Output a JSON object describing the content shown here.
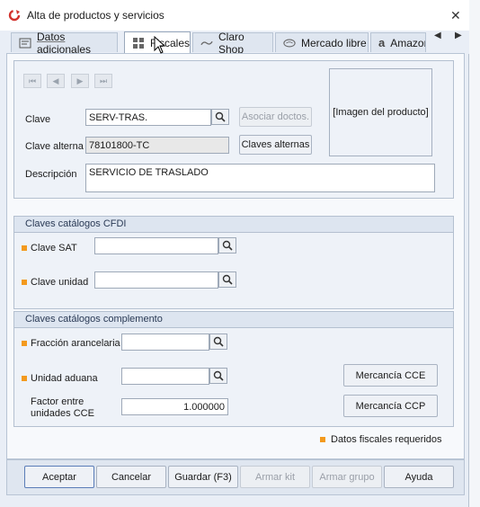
{
  "window": {
    "title": "Alta de productos y servicios",
    "close_glyph": "✕"
  },
  "tabs": [
    {
      "label": "Datos adicionales",
      "icon": "datos-icon"
    },
    {
      "label": "Fiscales",
      "icon": "grid-icon"
    },
    {
      "label": "Claro Shop",
      "icon": "claro-icon"
    },
    {
      "label": "Mercado libre",
      "icon": "mercado-icon"
    },
    {
      "label": "Amazon",
      "icon": "amazon-icon"
    }
  ],
  "tab_scroll": {
    "left": "◀",
    "right": "▶"
  },
  "nav": {
    "first": "⏮",
    "prev": "◀",
    "next": "▶",
    "last": "⏭"
  },
  "product": {
    "clave_label": "Clave",
    "clave_value": "SERV-TRAS.",
    "asociar_label": "Asociar doctos.",
    "clave_alterna_label": "Clave alterna",
    "clave_alterna_value": "78101800-TC",
    "claves_alternas_label": "Claves alternas",
    "descripcion_label": "Descripción",
    "descripcion_value": "SERVICIO DE TRASLADO",
    "image_placeholder": "[Imagen del producto]"
  },
  "cfdi": {
    "title": "Claves catálogos CFDI",
    "clave_sat_label": "Clave SAT",
    "clave_sat_value": "",
    "clave_unidad_label": "Clave unidad",
    "clave_unidad_value": ""
  },
  "complemento": {
    "title": "Claves catálogos complemento",
    "fraccion_label": "Fracción arancelaria",
    "fraccion_value": "",
    "unidad_aduana_label": "Unidad aduana",
    "unidad_aduana_value": "",
    "factor_label_1": "Factor entre",
    "factor_label_2": "unidades CCE",
    "factor_value": "1.000000",
    "mercancia_cce_label": "Mercancía CCE",
    "mercancia_ccp_label": "Mercancía CCP"
  },
  "legend": {
    "required_label": "Datos fiscales requeridos"
  },
  "footer": {
    "aceptar": "Aceptar",
    "cancelar": "Cancelar",
    "guardar": "Guardar (F3)",
    "armar_kit": "Armar kit",
    "armar_grupo": "Armar grupo",
    "ayuda": "Ayuda"
  },
  "colors": {
    "required": "#f39a1e",
    "accent_border": "#5b7db8"
  }
}
